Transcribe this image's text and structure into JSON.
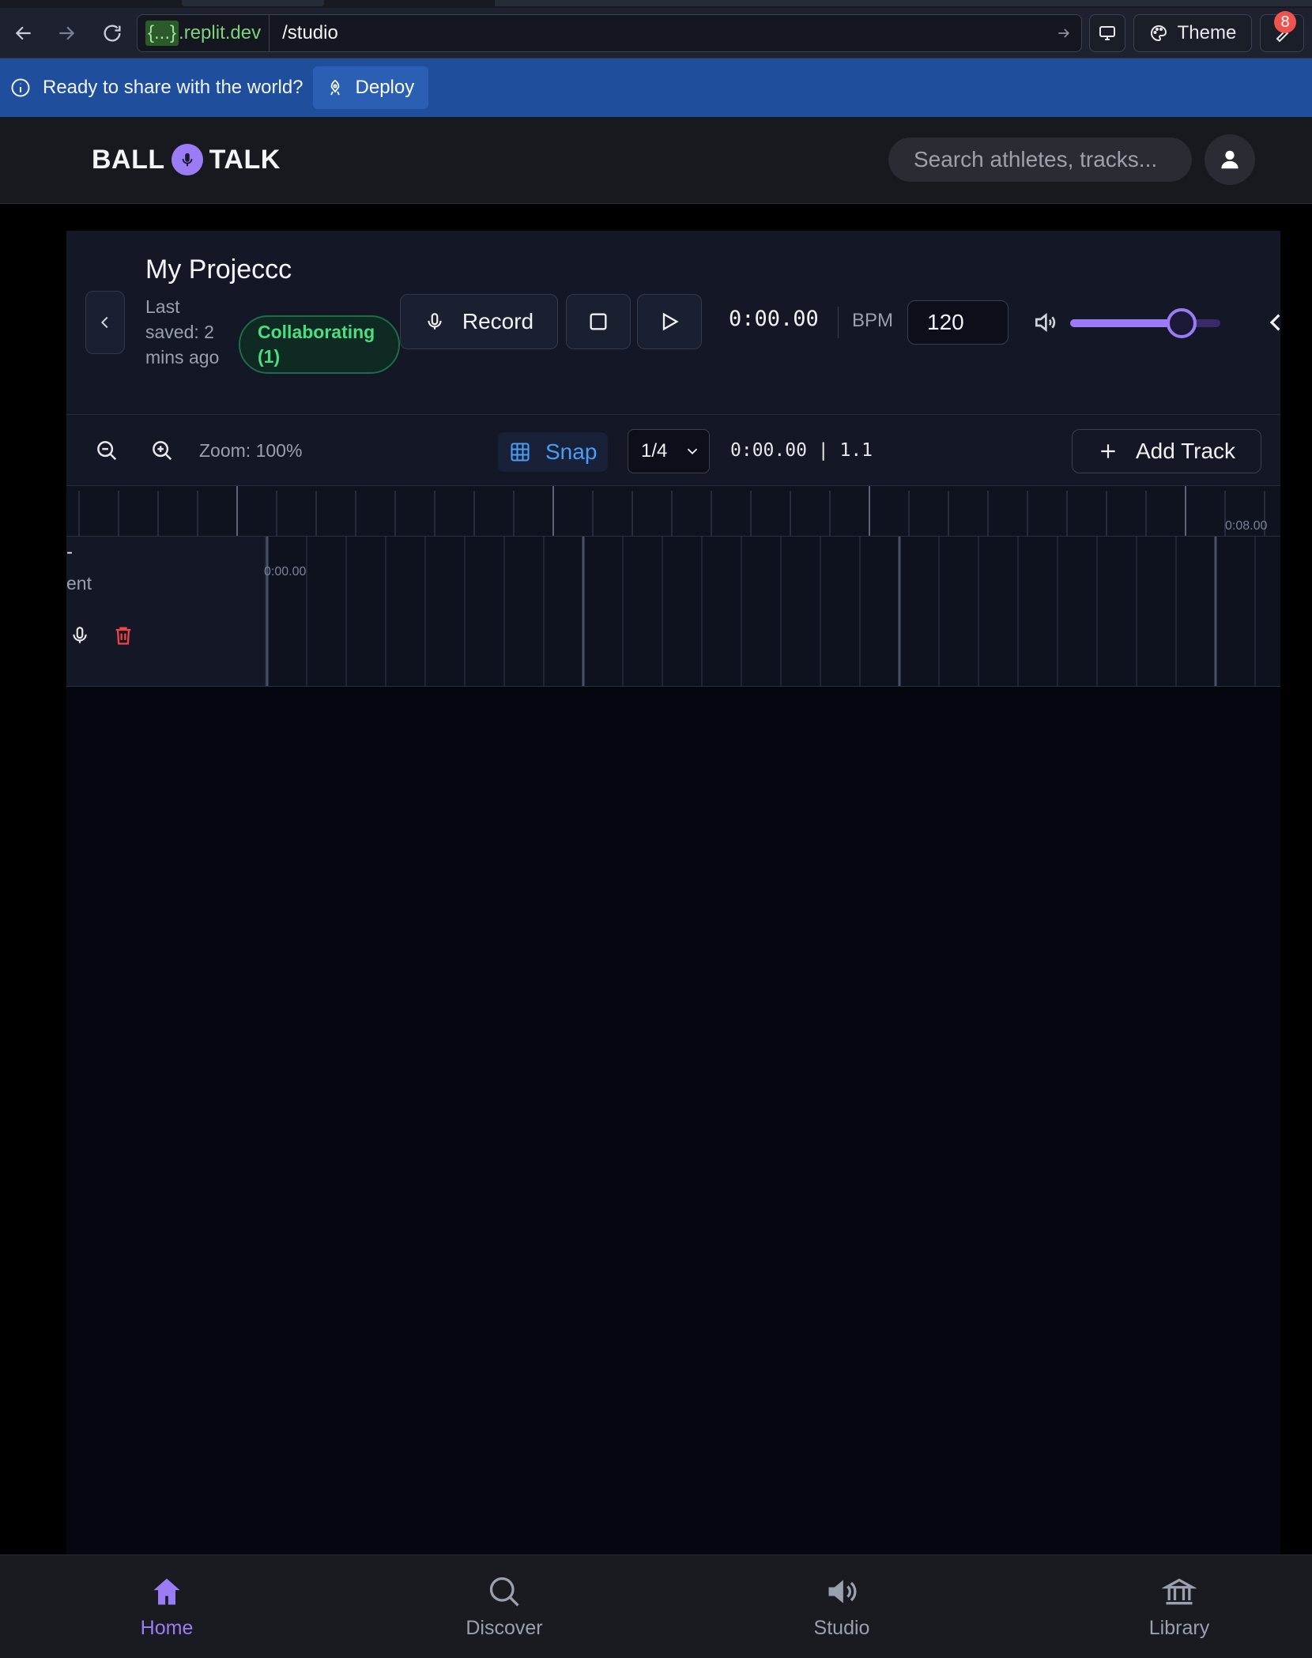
{
  "browser": {
    "url_host_brace": "{...}",
    "url_host_rest": ".replit.dev",
    "url_path": "/studio",
    "theme_label": "Theme",
    "notification_count": "8"
  },
  "banner": {
    "message": "Ready to share with the world?",
    "deploy_label": "Deploy"
  },
  "header": {
    "logo_left": "BALL",
    "logo_right": "TALK",
    "search_placeholder": "Search athletes, tracks..."
  },
  "studio": {
    "project_title": "My Projeccc",
    "last_saved": "Last saved: 2 mins ago",
    "collab_label": "Collaborating (1)",
    "record_label": "Record",
    "time": "0:00.00",
    "bpm_label": "BPM",
    "bpm_value": "120",
    "volume": 0.74,
    "zoom_label": "Zoom: 100%",
    "snap_label": "Snap",
    "grid_value": "1/4",
    "position_readout": "0:00.00 | 1.1",
    "add_track_label": "Add Track",
    "ruler_end_label": "0:08.00",
    "lane_start_label": "0:00.00",
    "track": {
      "name": "-",
      "subtitle": "ent"
    }
  },
  "bottom_nav": [
    {
      "label": "Home",
      "icon": "home-icon",
      "active": true
    },
    {
      "label": "Discover",
      "icon": "search-icon",
      "active": false
    },
    {
      "label": "Studio",
      "icon": "speaker-icon",
      "active": false
    },
    {
      "label": "Library",
      "icon": "library-icon",
      "active": false
    }
  ],
  "colors": {
    "accent": "#9b7cf6",
    "banner": "#1f4e9c",
    "snap": "#4a9cf7",
    "collab": "#4ade80",
    "danger": "#ef4444"
  }
}
